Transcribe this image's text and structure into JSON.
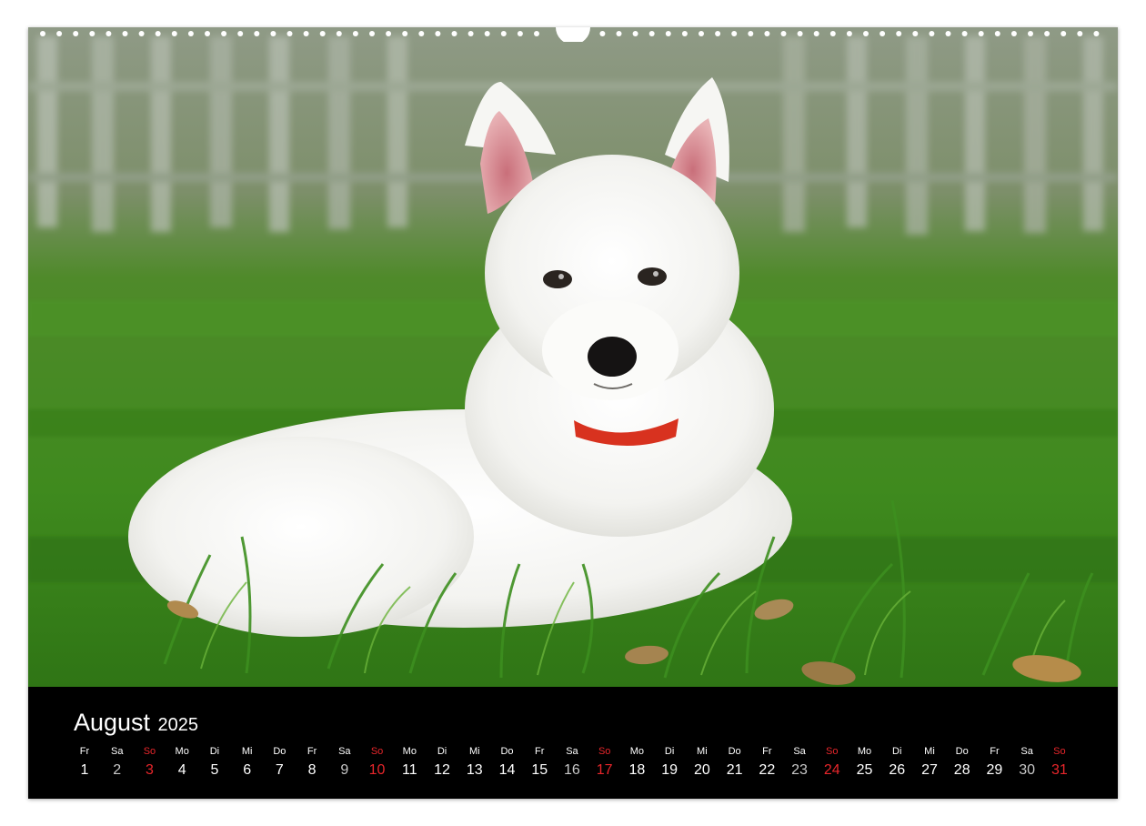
{
  "calendar": {
    "month": "August",
    "year": "2025",
    "colors": {
      "sunday": "#e8262b",
      "saturday": "#c8c8c8",
      "weekday": "#ffffff",
      "background": "#000000"
    },
    "days": [
      {
        "dow": "Fr",
        "num": "1"
      },
      {
        "dow": "Sa",
        "num": "2"
      },
      {
        "dow": "So",
        "num": "3"
      },
      {
        "dow": "Mo",
        "num": "4"
      },
      {
        "dow": "Di",
        "num": "5"
      },
      {
        "dow": "Mi",
        "num": "6"
      },
      {
        "dow": "Do",
        "num": "7"
      },
      {
        "dow": "Fr",
        "num": "8"
      },
      {
        "dow": "Sa",
        "num": "9"
      },
      {
        "dow": "So",
        "num": "10"
      },
      {
        "dow": "Mo",
        "num": "11"
      },
      {
        "dow": "Di",
        "num": "12"
      },
      {
        "dow": "Mi",
        "num": "13"
      },
      {
        "dow": "Do",
        "num": "14"
      },
      {
        "dow": "Fr",
        "num": "15"
      },
      {
        "dow": "Sa",
        "num": "16"
      },
      {
        "dow": "So",
        "num": "17"
      },
      {
        "dow": "Mo",
        "num": "18"
      },
      {
        "dow": "Di",
        "num": "19"
      },
      {
        "dow": "Mi",
        "num": "20"
      },
      {
        "dow": "Do",
        "num": "21"
      },
      {
        "dow": "Fr",
        "num": "22"
      },
      {
        "dow": "Sa",
        "num": "23"
      },
      {
        "dow": "So",
        "num": "24"
      },
      {
        "dow": "Mo",
        "num": "25"
      },
      {
        "dow": "Di",
        "num": "26"
      },
      {
        "dow": "Mi",
        "num": "27"
      },
      {
        "dow": "Do",
        "num": "28"
      },
      {
        "dow": "Fr",
        "num": "29"
      },
      {
        "dow": "Sa",
        "num": "30"
      },
      {
        "dow": "So",
        "num": "31"
      }
    ]
  },
  "photo": {
    "subject": "white-puppy",
    "colors": {
      "grass": "#3f8a1e",
      "grass_dark": "#2c6a14",
      "fence": "#9ea99a",
      "fur": "#f4f4f2",
      "collar": "#d8321f"
    }
  }
}
